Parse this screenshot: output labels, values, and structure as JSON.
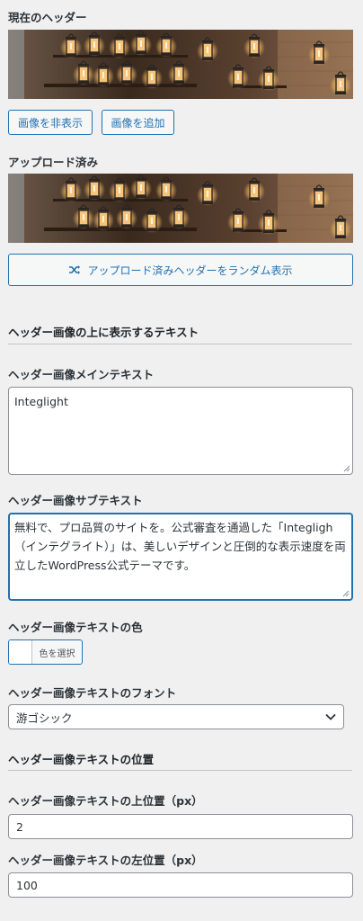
{
  "current_header": {
    "label": "現在のヘッダー",
    "hide_button": "画像を非表示",
    "add_button": "画像を追加"
  },
  "uploaded": {
    "label": "アップロード済み",
    "random_button": "アップロード済みヘッダーをランダム表示"
  },
  "text_section": {
    "title": "ヘッダー画像の上に表示するテキスト",
    "main_text_label": "ヘッダー画像メインテキスト",
    "main_text_value": "Integlight",
    "sub_text_label": "ヘッダー画像サブテキスト",
    "sub_text_value": "無料で、プロ品質のサイトを。公式審査を通過した「Integligh（インテグライト）」は、美しいデザインと圧倒的な表示速度を両立したWordPress公式テーマです。",
    "color_label": "ヘッダー画像テキストの色",
    "color_button": "色を選択",
    "font_label": "ヘッダー画像テキストのフォント",
    "font_value": "游ゴシック"
  },
  "position_section": {
    "title": "ヘッダー画像テキストの位置",
    "top_label": "ヘッダー画像テキストの上位置（px）",
    "top_value": "2",
    "left_label": "ヘッダー画像テキストの左位置（px）",
    "left_value": "100"
  },
  "colors": {
    "accent": "#2271b1",
    "background": "#f0f0f1"
  }
}
